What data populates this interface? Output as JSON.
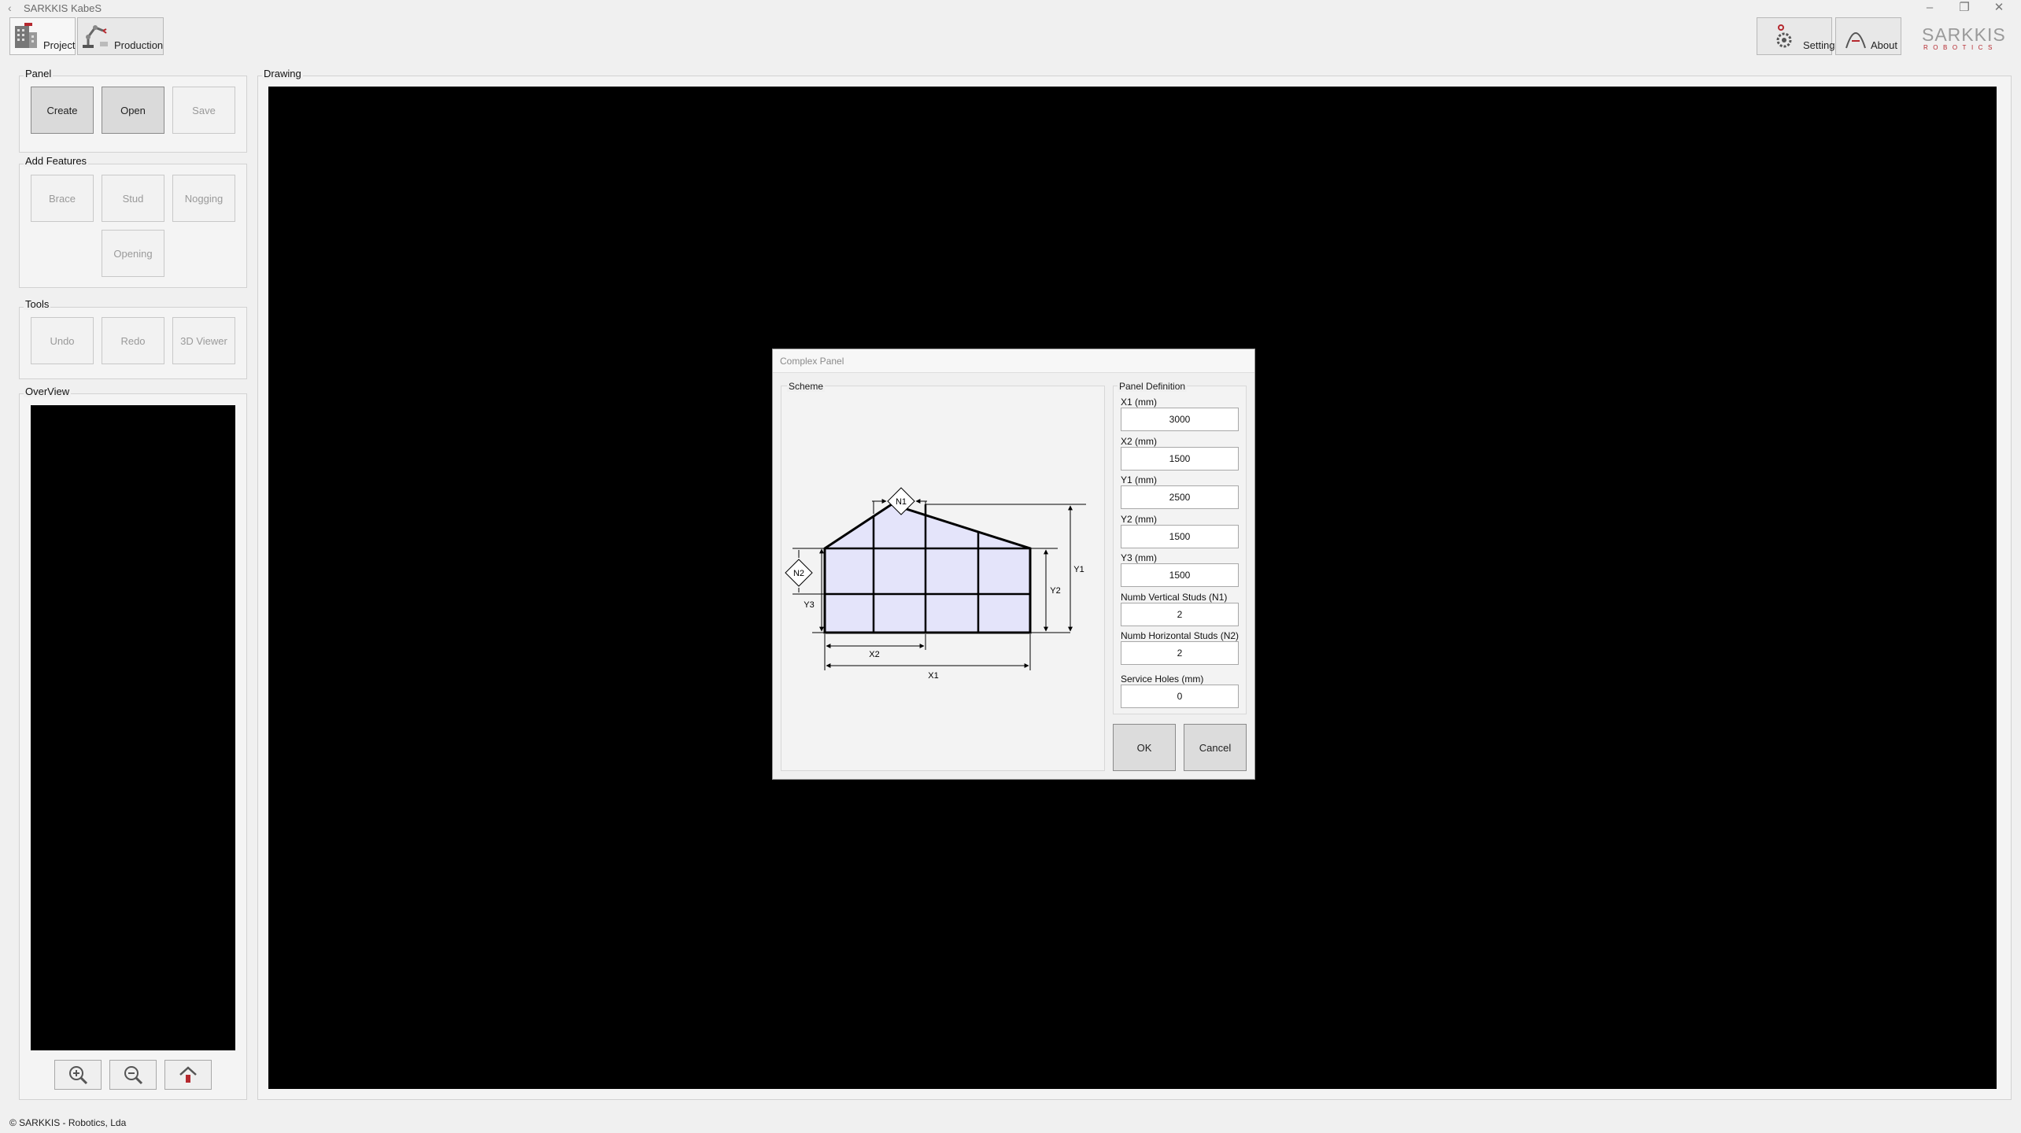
{
  "window": {
    "title": "SARKKIS KabeS",
    "controls": [
      "minimize-icon",
      "restore-icon",
      "close-icon"
    ]
  },
  "ribbon": {
    "tabs": [
      {
        "label": "Project",
        "icon": "building-icon"
      },
      {
        "label": "Production",
        "icon": "robot-arm-icon"
      }
    ],
    "right": [
      {
        "label": "Settings",
        "icon": "gear-icon"
      },
      {
        "label": "About",
        "icon": "arch-icon"
      }
    ],
    "logo": {
      "line1": "SARKKIS",
      "line2": "ROBOTICS",
      "color": "#b5282e"
    }
  },
  "panel_group": {
    "title": "Panel",
    "buttons": [
      "Create",
      "Open",
      "Save"
    ]
  },
  "features_group": {
    "title": "Add Features",
    "buttons": [
      "Brace",
      "Stud",
      "Nogging",
      "Opening"
    ]
  },
  "tools_group": {
    "title": "Tools",
    "buttons": [
      "Undo",
      "Redo",
      "3D Viewer"
    ]
  },
  "overview_group": {
    "title": "OverView",
    "zoom_buttons": [
      "zoom-in-icon",
      "zoom-out-icon",
      "home-icon"
    ]
  },
  "drawing": {
    "title": "Drawing"
  },
  "dialog": {
    "title": "Complex Panel",
    "scheme_title": "Scheme",
    "definition_title": "Panel Definition",
    "scheme_labels": {
      "n1": "N1",
      "n2": "N2",
      "x1": "X1",
      "x2": "X2",
      "y1": "Y1",
      "y2": "Y2",
      "y3": "Y3"
    },
    "fields": [
      {
        "label": "X1 (mm)",
        "value": "3000"
      },
      {
        "label": "X2 (mm)",
        "value": "1500"
      },
      {
        "label": "Y1 (mm)",
        "value": "2500"
      },
      {
        "label": "Y2 (mm)",
        "value": "1500"
      },
      {
        "label": "Y3 (mm)",
        "value": "1500"
      },
      {
        "label": "Numb Vertical Studs (N1)",
        "value": "2"
      },
      {
        "label": "Numb Horizontal Studs (N2)",
        "value": "2"
      },
      {
        "label": "Service Holes (mm)",
        "value": "0"
      }
    ],
    "ok_label": "OK",
    "cancel_label": "Cancel",
    "panel_fill": "#e4e4fa"
  },
  "footer": {
    "text": "© SARKKIS - Robotics, Lda"
  }
}
